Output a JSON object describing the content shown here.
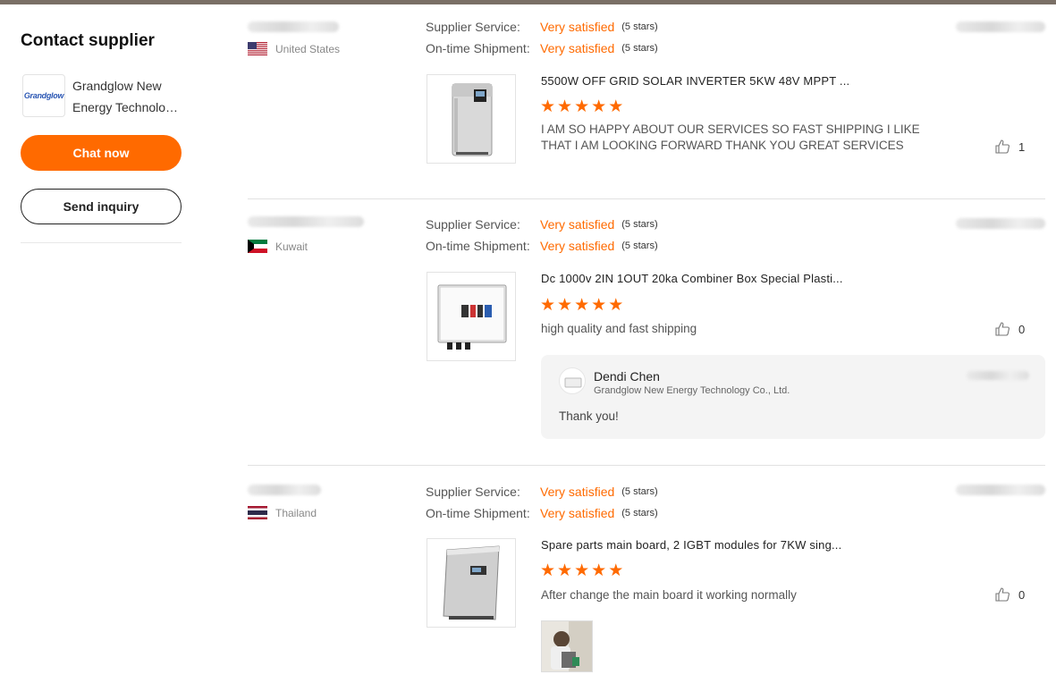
{
  "sidebar": {
    "title": "Contact supplier",
    "logo_text": "Grandglow",
    "company_line1": "Grandglow New",
    "company_line2": "Energy Technolog...",
    "chat_label": "Chat now",
    "inquiry_label": "Send inquiry"
  },
  "labels": {
    "supplier_service": "Supplier Service:",
    "on_time_shipment": "On-time Shipment:"
  },
  "reviews": [
    {
      "country": "United States",
      "flag": "us-flag",
      "supplier_service": "Very satisfied",
      "supplier_service_stars": "(5 stars)",
      "shipment": "Very satisfied",
      "shipment_stars": "(5 stars)",
      "product_title": "5500W OFF GRID SOLAR INVERTER 5KW 48V MPPT ...",
      "rating": 5,
      "text": "I AM SO HAPPY ABOUT OUR SERVICES SO FAST SHIPPING I LIKE THAT I AM LOOKING FORWARD THANK YOU GREAT SERVICES",
      "likes": "1"
    },
    {
      "country": "Kuwait",
      "flag": "kuwait-flag",
      "supplier_service": "Very satisfied",
      "supplier_service_stars": "(5 stars)",
      "shipment": "Very satisfied",
      "shipment_stars": "(5 stars)",
      "product_title": "Dc 1000v 2IN 1OUT 20ka Combiner Box Special Plasti...",
      "rating": 5,
      "text": "high quality and fast shipping",
      "likes": "0",
      "reply": {
        "name": "Dendi Chen",
        "company": "Grandglow New Energy Technology Co., Ltd.",
        "text": "Thank you!"
      }
    },
    {
      "country": "Thailand",
      "flag": "thailand-flag",
      "supplier_service": "Very satisfied",
      "supplier_service_stars": "(5 stars)",
      "shipment": "Very satisfied",
      "shipment_stars": "(5 stars)",
      "product_title": "Spare parts main board, 2 IGBT modules for 7KW sing...",
      "rating": 5,
      "text": "After change the main board it working normally",
      "likes": "0"
    }
  ],
  "colors": {
    "accent": "#ff6a00",
    "top_bar": "#7a6f66"
  }
}
